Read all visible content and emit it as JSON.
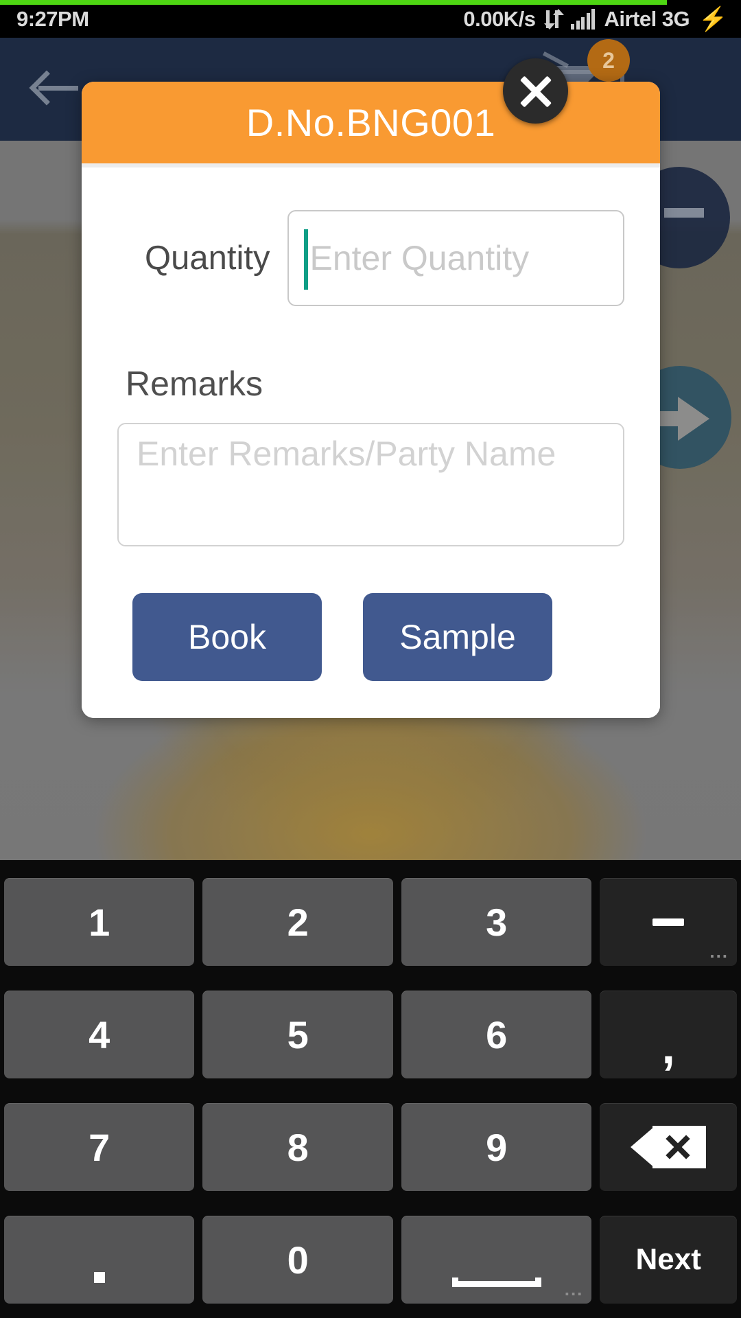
{
  "status_bar": {
    "time": "9:27PM",
    "network_speed": "0.00K/s",
    "carrier": "Airtel 3G",
    "data_arrows_icon": "data-transfer-icon",
    "signal_icon": "signal-bars-icon",
    "battery_icon": "charging-bolt-icon",
    "progress_color": "#4ed613"
  },
  "app_bar": {
    "back_icon": "back-arrow-icon",
    "cart_icon": "cart-icon",
    "cart_badge": "2",
    "mail_icon": "mail-icon",
    "background_color": "#1d2a42"
  },
  "background": {
    "image_alt": "gold-bangle-photo",
    "nav_prev_icon": "circle-prev-button",
    "nav_next_icon": "circle-next-arrow-button"
  },
  "dialog": {
    "title": "D.No.BNG001",
    "header_color": "#f99a32",
    "close_icon": "close-x-icon",
    "quantity": {
      "label": "Quantity",
      "value": "",
      "placeholder": "Enter Quantity",
      "caret_color": "#0e9e86"
    },
    "remarks": {
      "label": "Remarks",
      "value": "",
      "placeholder": "Enter Remarks/Party Name"
    },
    "buttons": {
      "book_label": "Book",
      "sample_label": "Sample",
      "button_color": "#41598f"
    }
  },
  "keyboard": {
    "rows": [
      [
        {
          "label": "1",
          "name": "key-1",
          "type": "num"
        },
        {
          "label": "2",
          "name": "key-2",
          "type": "num"
        },
        {
          "label": "3",
          "name": "key-3",
          "type": "num"
        },
        {
          "label": "-",
          "name": "key-dash",
          "type": "fn",
          "more": "..."
        }
      ],
      [
        {
          "label": "4",
          "name": "key-4",
          "type": "num"
        },
        {
          "label": "5",
          "name": "key-5",
          "type": "num"
        },
        {
          "label": "6",
          "name": "key-6",
          "type": "num"
        },
        {
          "label": ",",
          "name": "key-comma",
          "type": "fn"
        }
      ],
      [
        {
          "label": "7",
          "name": "key-7",
          "type": "num"
        },
        {
          "label": "8",
          "name": "key-8",
          "type": "num"
        },
        {
          "label": "9",
          "name": "key-9",
          "type": "num"
        },
        {
          "label": "",
          "name": "key-backspace",
          "type": "fn",
          "icon": "backspace-icon"
        }
      ],
      [
        {
          "label": ".",
          "name": "key-period",
          "type": "num"
        },
        {
          "label": "0",
          "name": "key-0",
          "type": "num"
        },
        {
          "label": "",
          "name": "key-space",
          "type": "num",
          "icon": "space-icon",
          "more": "..."
        },
        {
          "label": "Next",
          "name": "key-next",
          "type": "fn"
        }
      ]
    ]
  }
}
